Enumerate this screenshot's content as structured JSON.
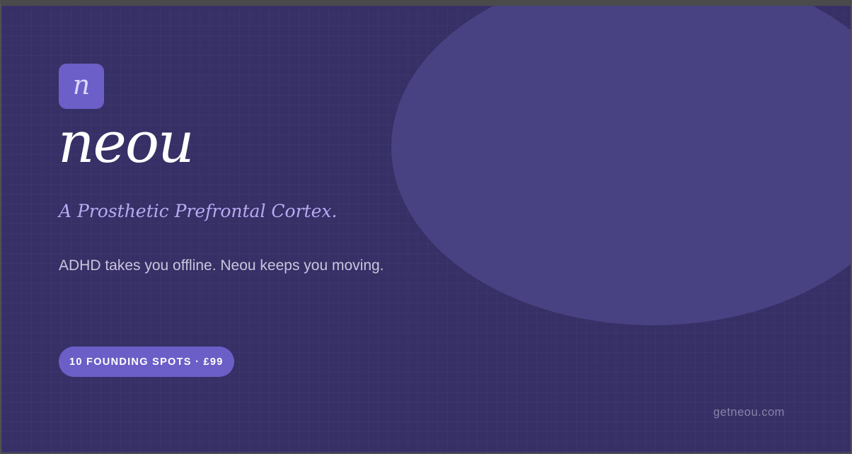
{
  "brand": {
    "logo_letter": "n",
    "name": "neou",
    "tagline": "A Prosthetic Prefrontal Cortex.",
    "subtitle": "ADHD takes you offline. Neou keeps you moving.",
    "domain": "getneou.com"
  },
  "badge": {
    "label": "10 FOUNDING SPOTS · £99"
  },
  "colors": {
    "background": "#373067",
    "blob": "#484283",
    "accent": "#6b5ec7",
    "tagline": "#b6aaf2",
    "wordmark": "#ffffff"
  }
}
